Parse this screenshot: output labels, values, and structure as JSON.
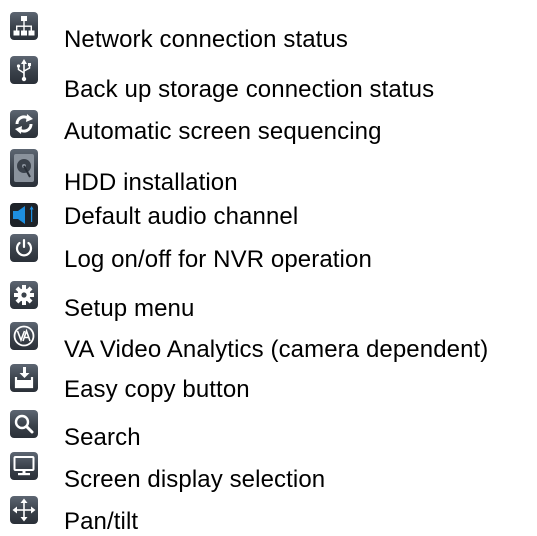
{
  "legend": {
    "items": [
      {
        "icon": "network-icon",
        "label": "Network connection status"
      },
      {
        "icon": "usb-icon",
        "label": "Back up storage connection status"
      },
      {
        "icon": "sequence-arrows-icon",
        "label": "Automatic screen sequencing"
      },
      {
        "icon": "hdd-icon",
        "label": "HDD installation"
      },
      {
        "icon": "speaker-icon",
        "label": "Default audio channel"
      },
      {
        "icon": "power-icon",
        "label": "Log on/off for NVR operation"
      },
      {
        "icon": "gear-icon",
        "label": "Setup menu"
      },
      {
        "icon": "va-icon",
        "label": "VA Video Analytics (camera dependent)"
      },
      {
        "icon": "easy-copy-icon",
        "label": "Easy copy button"
      },
      {
        "icon": "search-icon",
        "label": "Search"
      },
      {
        "icon": "monitor-icon",
        "label": "Screen display selection"
      },
      {
        "icon": "pan-tilt-icon",
        "label": "Pan/tilt"
      }
    ]
  },
  "colors": {
    "icon_bg_top": "#5d6672",
    "icon_bg_bottom": "#2a3038",
    "icon_glyph": "#ffffff",
    "speaker_accent": "#1e8fe0",
    "text": "#000000"
  }
}
